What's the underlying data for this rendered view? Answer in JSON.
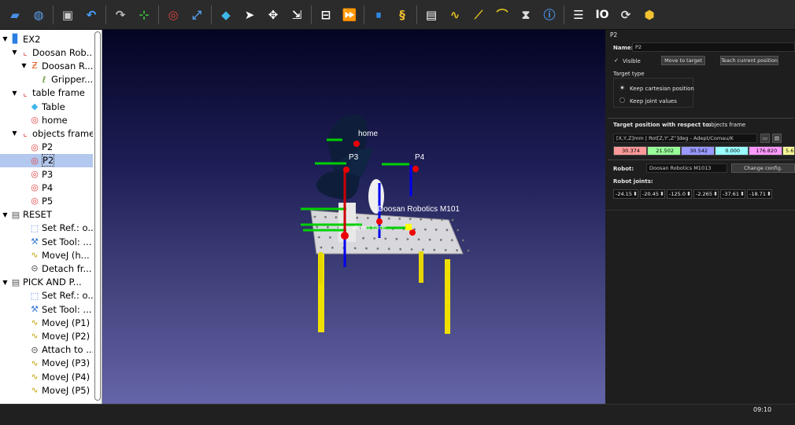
{
  "toolbar": {
    "io_label": "IO",
    "icons": [
      "open-icon",
      "globe-icon",
      "save-icon",
      "undo-icon",
      "redo-icon",
      "add-frame-icon",
      "add-target-icon",
      "fit-all-icon",
      "cube-view-icon",
      "select-icon",
      "move-frame-icon",
      "move-reference-icon",
      "tool-select-icon",
      "fast-run-icon",
      "pause-icon",
      "python-icon",
      "add-program-icon",
      "movej-icon",
      "movel-icon",
      "movec-icon",
      "pause-instruction-icon",
      "info-icon",
      "list-icon",
      "io-icon",
      "reset-icon",
      "collision-icon"
    ]
  },
  "tree": {
    "items": [
      {
        "label": "EX2",
        "name": "tree-item-ex2",
        "icon": "station-icon"
      },
      {
        "label": "Doosan Rob...",
        "name": "tree-item-doosan-robot-base",
        "icon": "frame-icon"
      },
      {
        "label": "Doosan R...",
        "name": "tree-item-doosan-robot",
        "icon": "robot-icon"
      },
      {
        "label": "Gripper...",
        "name": "tree-item-gripper",
        "icon": "gripper-icon"
      },
      {
        "label": "table frame",
        "name": "tree-item-table-frame",
        "icon": "frame-icon"
      },
      {
        "label": "Table",
        "name": "tree-item-table",
        "icon": "object-icon"
      },
      {
        "label": "home",
        "name": "tree-item-home",
        "icon": "target-icon"
      },
      {
        "label": "objects frame",
        "name": "tree-item-objects-frame",
        "icon": "frame-icon"
      },
      {
        "label": "P2",
        "name": "tree-item-p2-a",
        "icon": "target-icon"
      },
      {
        "label": "P2",
        "name": "tree-item-p2-b",
        "icon": "target-icon"
      },
      {
        "label": "P3",
        "name": "tree-item-p3",
        "icon": "target-icon"
      },
      {
        "label": "P4",
        "name": "tree-item-p4",
        "icon": "target-icon"
      },
      {
        "label": "P5",
        "name": "tree-item-p5",
        "icon": "target-icon"
      },
      {
        "label": "RESET",
        "name": "tree-item-reset",
        "icon": "program-icon"
      },
      {
        "label": "Set Ref.: o...",
        "name": "tree-item-reset-set-ref",
        "icon": "set-ref-icon"
      },
      {
        "label": "Set Tool: ...",
        "name": "tree-item-reset-set-tool",
        "icon": "set-tool-icon"
      },
      {
        "label": "MoveJ (h...",
        "name": "tree-item-reset-movej-home",
        "icon": "movej-icon"
      },
      {
        "label": "Detach fr...",
        "name": "tree-item-reset-detach",
        "icon": "detach-icon"
      },
      {
        "label": "PICK AND P...",
        "name": "tree-item-pick-and-place",
        "icon": "program-icon"
      },
      {
        "label": "Set Ref.: o...",
        "name": "tree-item-pnp-set-ref",
        "icon": "set-ref-icon"
      },
      {
        "label": "Set Tool: ...",
        "name": "tree-item-pnp-set-tool",
        "icon": "set-tool-icon"
      },
      {
        "label": "MoveJ (P1)",
        "name": "tree-item-movej-p1",
        "icon": "movej-icon"
      },
      {
        "label": "MoveJ (P2)",
        "name": "tree-item-movej-p2",
        "icon": "movej-icon"
      },
      {
        "label": "Attach to ...",
        "name": "tree-item-attach",
        "icon": "attach-icon"
      },
      {
        "label": "MoveJ (P3)",
        "name": "tree-item-movej-p3",
        "icon": "movej-icon"
      },
      {
        "label": "MoveJ (P4)",
        "name": "tree-item-movej-p4",
        "icon": "movej-icon"
      },
      {
        "label": "MoveJ (P5)",
        "name": "tree-item-movej-p5",
        "icon": "movej-icon"
      }
    ]
  },
  "viewport": {
    "labels": {
      "home": "home",
      "p3": "P3",
      "p4": "P4",
      "robot": "Doosan Robotics M101",
      "objects_frame": "objects frame"
    }
  },
  "props": {
    "header": "P2",
    "name_label": "Name:",
    "name_value": "P2",
    "visible_label": "Visible",
    "move_to_target": "Move to target",
    "teach_current_position": "Teach current position",
    "target_type_label": "Target type",
    "keep_cartesian": "Keep cartesian position",
    "keep_joint": "Keep joint values",
    "target_position_label": "Target position with respect to:",
    "reference_frame": "objects frame",
    "pose_format": "[X,Y,Z]mm | Rot[Z,Y',Z'']deg - Adept/Comau/K",
    "pose_values": [
      "30.374",
      "21.502",
      "30.542",
      "0.000",
      "176.820",
      "5.6"
    ],
    "pose_colors": [
      "#ff9999",
      "#99ff99",
      "#9999ff",
      "#99ffff",
      "#ff99ff",
      "#ffff99"
    ],
    "robot_label": "Robot:",
    "robot_value": "Doosan Robotics M1013",
    "change_config": "Change config.",
    "robot_joints_label": "Robot joints:",
    "joints": [
      "-24.15",
      "-20.45",
      "-125.0",
      "-2.265",
      "-37.61",
      "-18.71"
    ]
  },
  "taskbar": {
    "time": "09:10"
  }
}
